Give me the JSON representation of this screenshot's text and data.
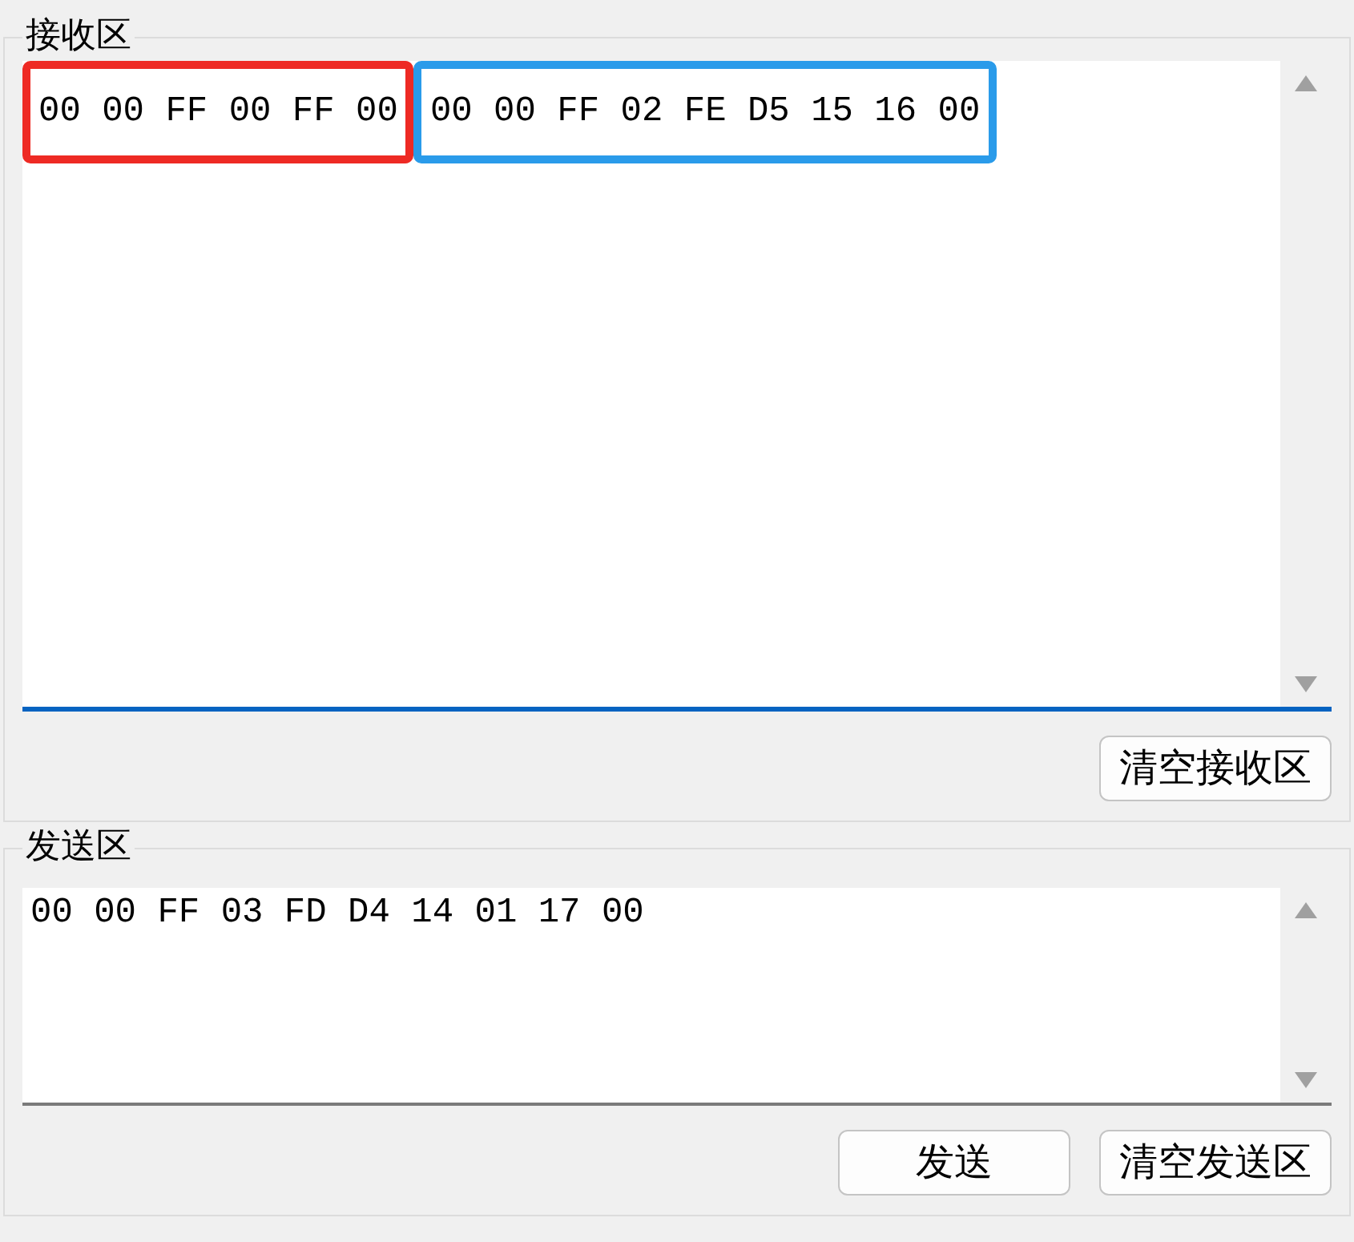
{
  "receive_group": {
    "title": "接收区",
    "segments": [
      {
        "text": "00 00 FF 00 FF 00",
        "color": "#ee2a24"
      },
      {
        "text": "00 00 FF 02 FE D5 15 16 00",
        "color": "#2a9bea"
      }
    ],
    "focused": true,
    "buttons": [
      "清空接收区"
    ]
  },
  "send_group": {
    "title": "发送区",
    "value": "00 00 FF 03 FD D4 14 01 17 00",
    "focused": false,
    "buttons": [
      "发送",
      "清空发送区"
    ]
  }
}
